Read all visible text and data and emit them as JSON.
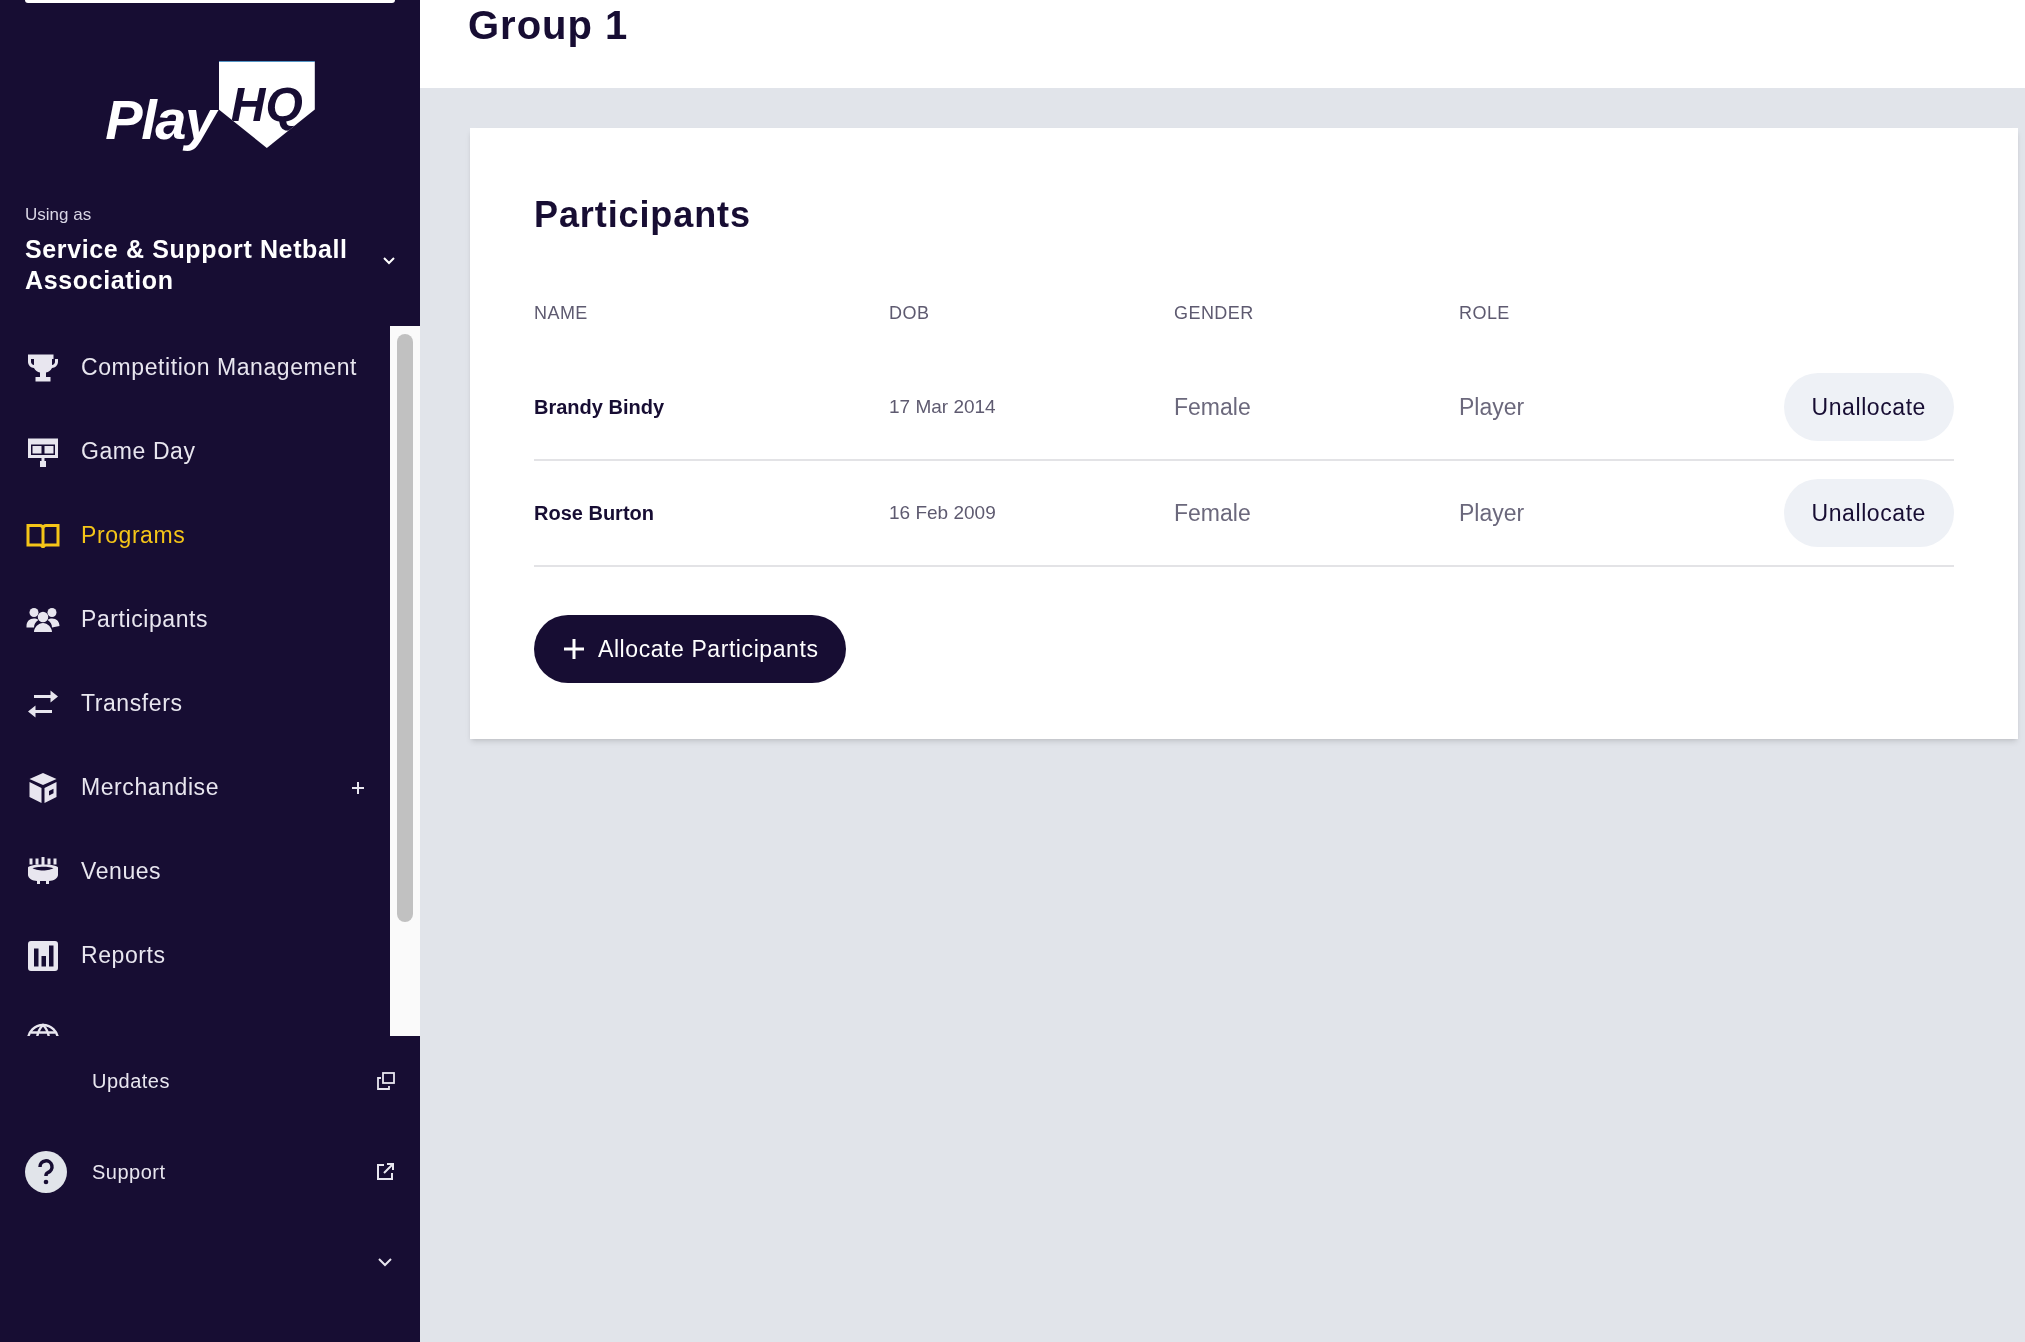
{
  "sidebar": {
    "logo": {
      "word": "Play",
      "badge": "HQ"
    },
    "account": {
      "caption": "Using as",
      "name": "Service & Support Netball Association"
    },
    "items": [
      {
        "kind": "trophy",
        "label": "Competition Management",
        "selected": false
      },
      {
        "kind": "scoreboard",
        "label": "Game Day",
        "selected": false
      },
      {
        "kind": "book",
        "label": "Programs",
        "selected": true
      },
      {
        "kind": "people",
        "label": "Participants",
        "selected": false
      },
      {
        "kind": "transfer",
        "label": "Transfers",
        "selected": false
      },
      {
        "kind": "box",
        "label": "Merchandise",
        "selected": false,
        "expandable": true
      },
      {
        "kind": "stadium",
        "label": "Venues",
        "selected": false
      },
      {
        "kind": "chart",
        "label": "Reports",
        "selected": false
      },
      {
        "kind": "globe",
        "selected": false
      }
    ],
    "footer": [
      {
        "kind": "updates",
        "label": "Updates"
      },
      {
        "kind": "support",
        "label": "Support"
      }
    ]
  },
  "page": {
    "title": "Group 1"
  },
  "card": {
    "title": "Participants",
    "columns": [
      "NAME",
      "DOB",
      "GENDER",
      "ROLE"
    ],
    "rows": [
      {
        "name": "Brandy Bindy",
        "dob": "17 Mar 2014",
        "gender": "Female",
        "role": "Player",
        "action": "Unallocate"
      },
      {
        "name": "Rose Burton",
        "dob": "16 Feb 2009",
        "gender": "Female",
        "role": "Player",
        "action": "Unallocate"
      }
    ],
    "button": "Allocate Participants"
  }
}
